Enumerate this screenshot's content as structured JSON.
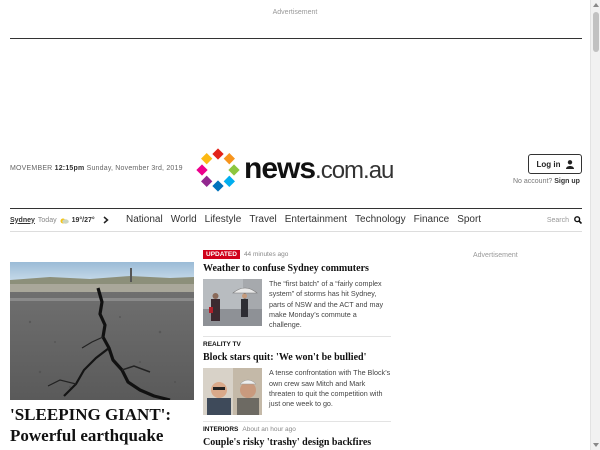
{
  "ads": {
    "top_label": "Advertisement",
    "right_label": "Advertisement"
  },
  "masthead": {
    "date_month": "MOVEMBER",
    "date_time": "12:15pm",
    "date_rest": "Sunday, November 3rd, 2019",
    "logo_bold": "news",
    "logo_domain": ".com.au",
    "logo_colors": [
      "#e2231a",
      "#f7941d",
      "#8dc63f",
      "#00aeef",
      "#0072bc",
      "#92278f",
      "#ec008c",
      "#fcb913"
    ]
  },
  "account": {
    "login_label": "Log in",
    "no_account": "No account?",
    "signup": "Sign up"
  },
  "weather": {
    "city": "Sydney",
    "today": "Today",
    "temps": "19°/27°"
  },
  "nav": {
    "items": [
      "National",
      "World",
      "Lifestyle",
      "Travel",
      "Entertainment",
      "Technology",
      "Finance",
      "Sport"
    ],
    "search": "Search"
  },
  "hero": {
    "headline": "'SLEEPING GIANT': Powerful earthquake"
  },
  "stories": [
    {
      "tag": "UPDATED",
      "time": "44 minutes ago",
      "title": "Weather to confuse Sydney commuters",
      "summary": "The “first batch” of a “fairly complex system” of storms has hit Sydney, parts of NSW and the ACT and may make Monday’s commute a challenge."
    },
    {
      "tag": "REALITY TV",
      "title": "Block stars quit: 'We won't be bullied'",
      "summary": "A tense confrontation with The Block’s own crew saw Mitch and Mark threaten to quit the competition with just one week to go."
    },
    {
      "tag": "INTERIORS",
      "time": "About an hour ago",
      "title": "Couple's risky 'trashy' design backfires"
    }
  ]
}
